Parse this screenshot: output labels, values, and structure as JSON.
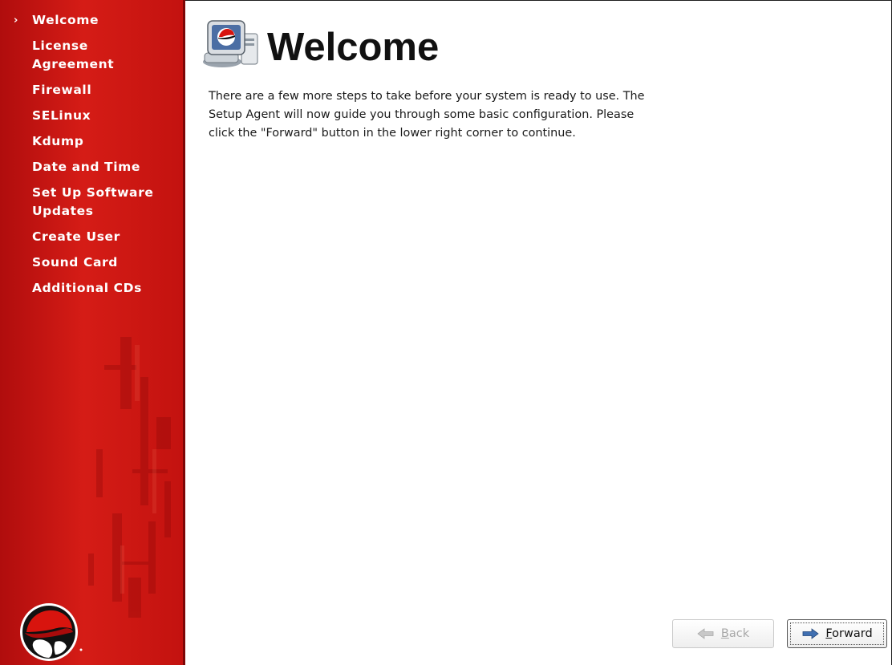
{
  "sidebar": {
    "current_marker": "›",
    "steps": [
      {
        "label": "Welcome"
      },
      {
        "label": "License\nAgreement"
      },
      {
        "label": "Firewall"
      },
      {
        "label": "SELinux"
      },
      {
        "label": "Kdump"
      },
      {
        "label": "Date and Time"
      },
      {
        "label": "Set Up Software\nUpdates"
      },
      {
        "label": "Create User"
      },
      {
        "label": "Sound Card"
      },
      {
        "label": "Additional CDs"
      }
    ],
    "current_index": 0,
    "logo_icon": "redhat-shadowman-logo"
  },
  "main": {
    "title": "Welcome",
    "header_icon": "computer-monitor-icon",
    "body": "There are a few more steps to take before your system is ready to use.  The\nSetup Agent will now guide you through some basic configuration.  Please\nclick the \"Forward\" button in the lower right corner to continue."
  },
  "buttons": {
    "back": {
      "mnemonic": "B",
      "rest": "ack",
      "icon": "arrow-left-icon",
      "enabled": false
    },
    "forward": {
      "mnemonic": "F",
      "rest": "orward",
      "icon": "arrow-right-icon",
      "enabled": true
    }
  },
  "colors": {
    "sidebar_red": "#d51c16",
    "sidebar_text": "#ffffff"
  }
}
